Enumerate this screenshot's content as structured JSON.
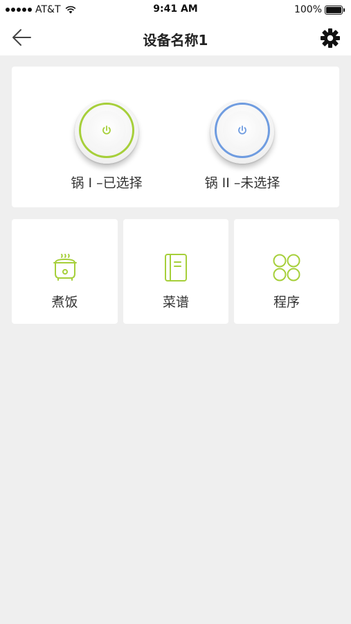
{
  "status_bar": {
    "carrier": "AT&T",
    "time": "9:41 AM",
    "battery": "100%"
  },
  "nav": {
    "title": "设备名称1",
    "back_icon": "back-arrow-icon",
    "settings_icon": "gear-icon"
  },
  "pots": [
    {
      "label": "锅 I –已选择",
      "ring_color": "#a6cf3a",
      "icon": "power-icon"
    },
    {
      "label": "锅 II –未选择",
      "ring_color": "#6f9ce0",
      "icon": "power-icon"
    }
  ],
  "tiles": [
    {
      "label": "煮饭",
      "icon": "rice-cooker-icon"
    },
    {
      "label": "菜谱",
      "icon": "recipe-book-icon"
    },
    {
      "label": "程序",
      "icon": "program-grid-icon"
    }
  ],
  "colors": {
    "accent_green": "#a6cf3a",
    "accent_blue": "#6f9ce0",
    "background": "#efefef"
  }
}
